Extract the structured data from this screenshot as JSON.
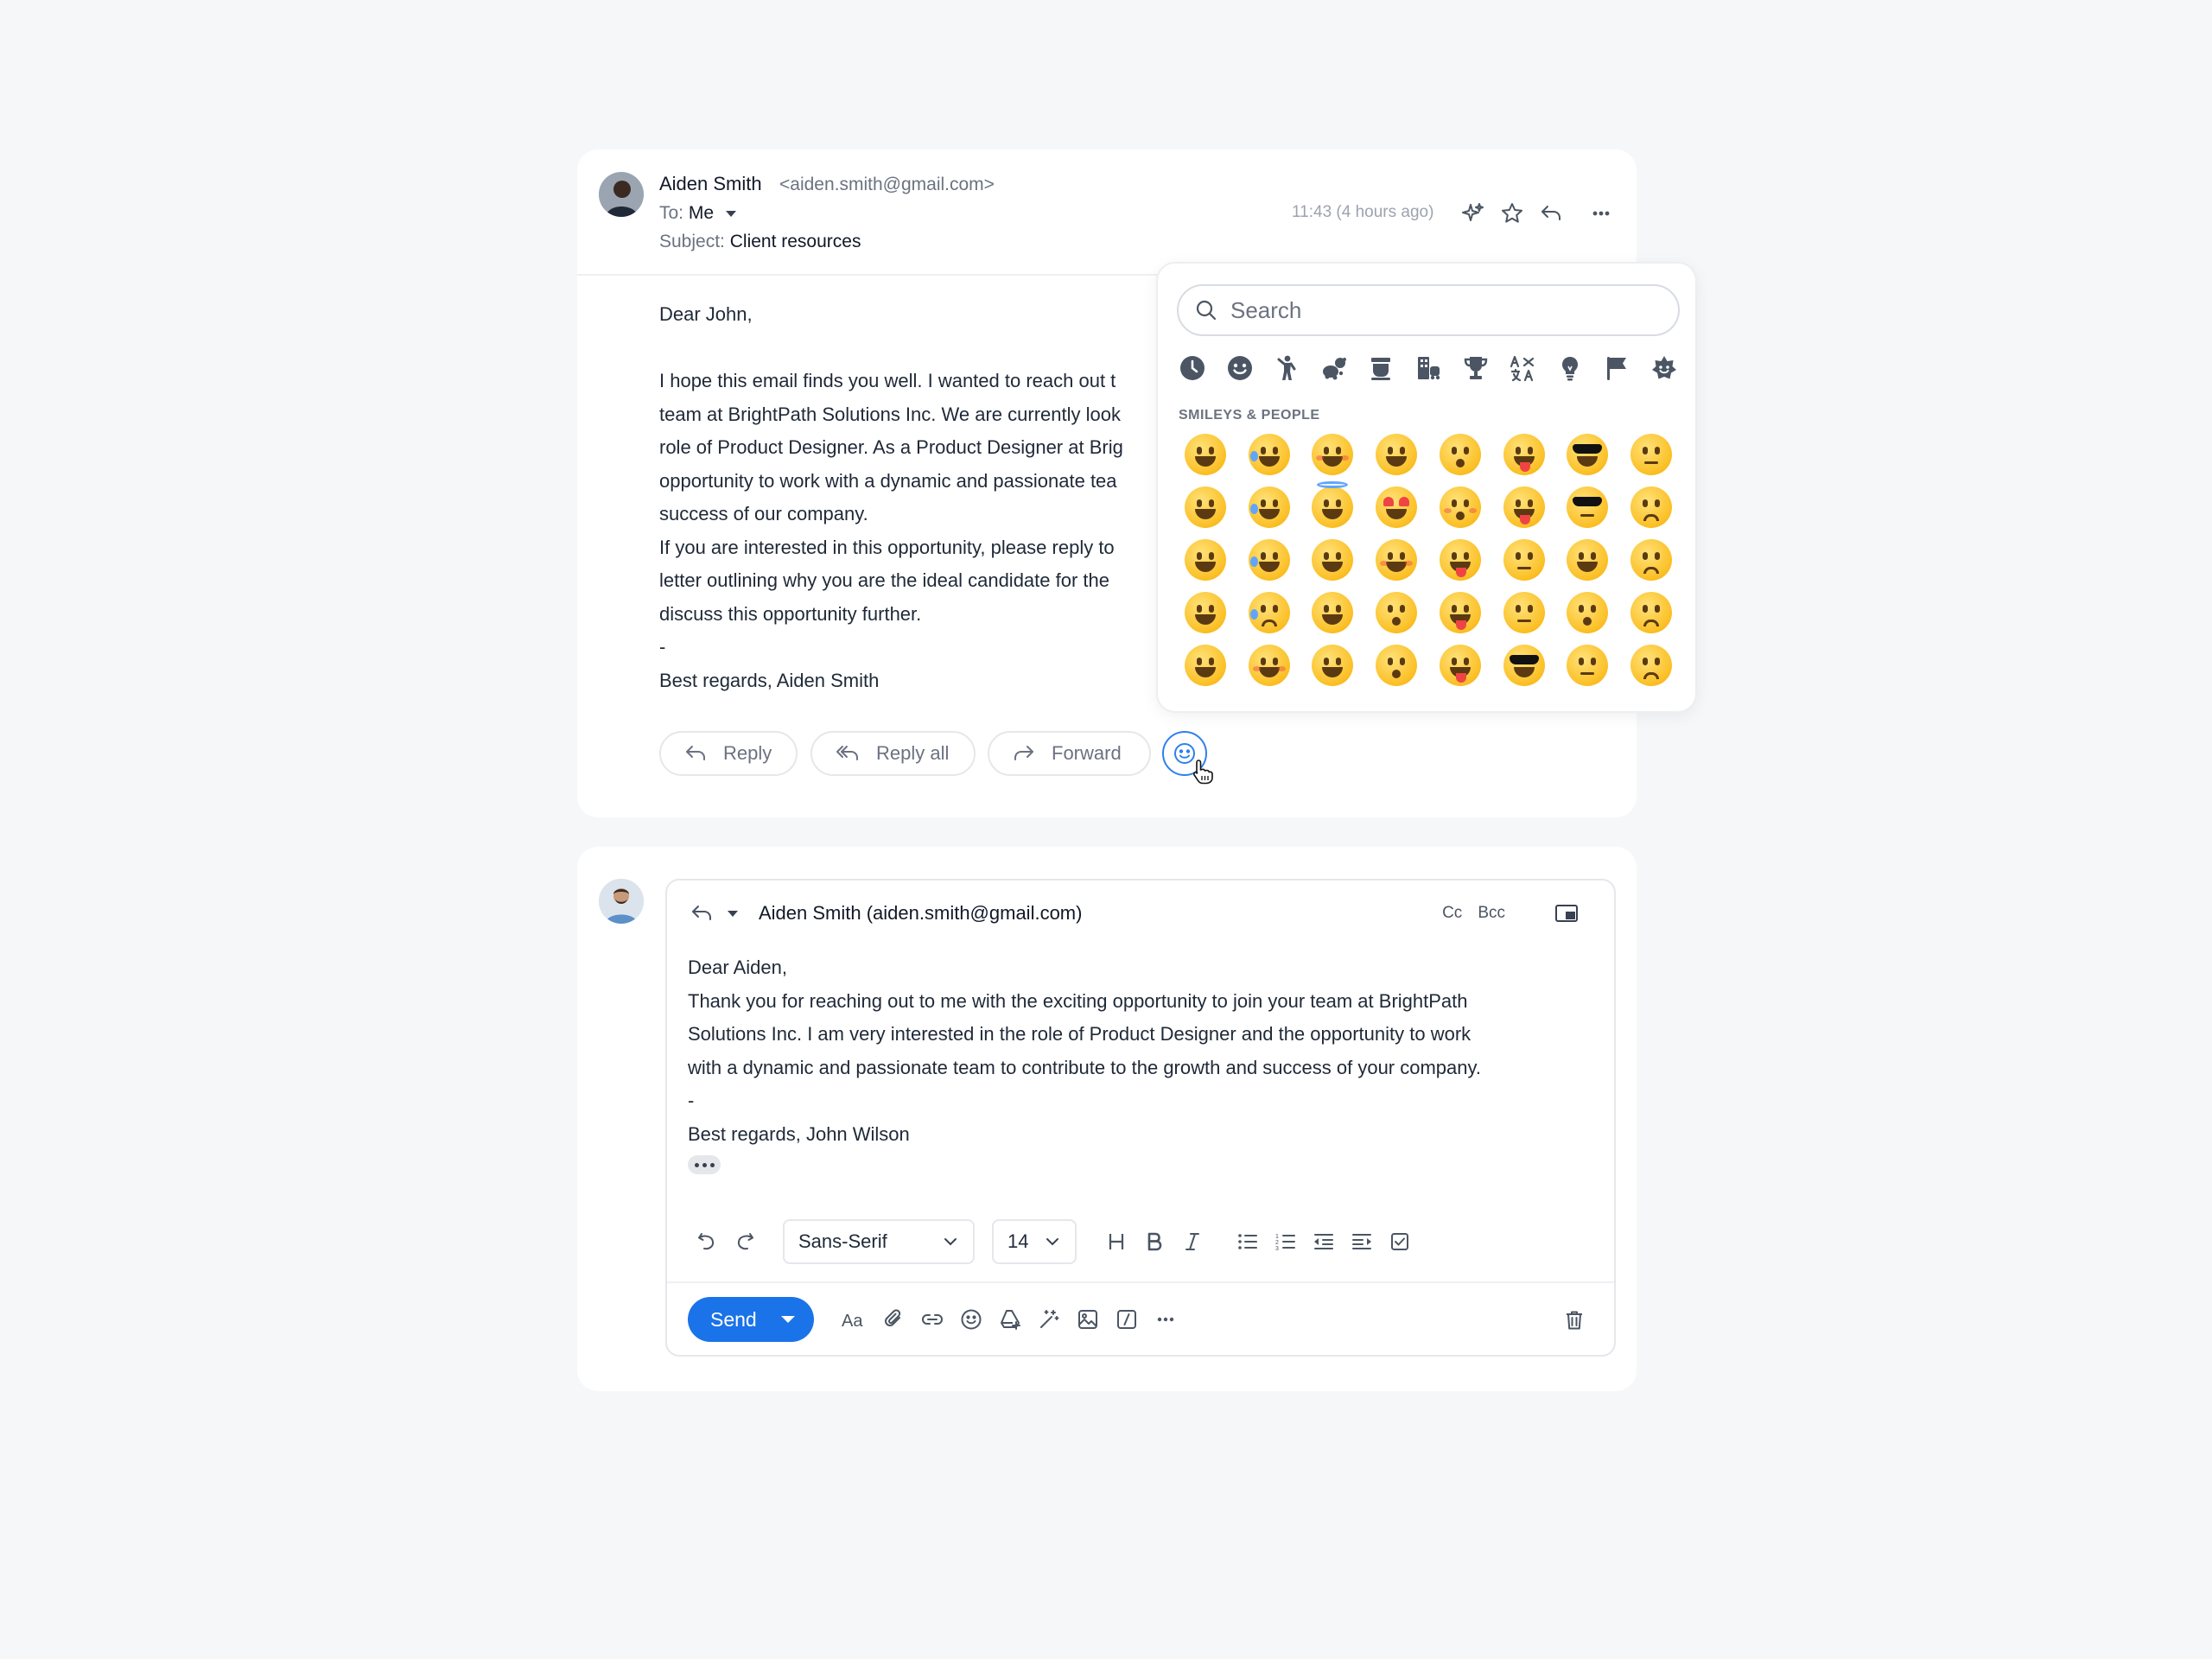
{
  "message": {
    "sender_name": "Aiden Smith",
    "sender_email": "<aiden.smith@gmail.com>",
    "to_label": "To:",
    "to_value": "Me",
    "subject_label": "Subject:",
    "subject_value": "Client resources",
    "time": "11:43 (4 hours ago)",
    "icons": [
      "sparkle-icon",
      "star-icon",
      "reply-icon",
      "more-icon"
    ],
    "body_lines": [
      "Dear John,",
      "",
      "I hope this email finds you well. I wanted to reach out t",
      "team at BrightPath Solutions Inc. We are currently look",
      "role of Product Designer. As a Product Designer at Brig",
      "opportunity to work with a dynamic and passionate tea",
      "success of our company.",
      "If you are interested in this opportunity, please reply to",
      "letter outlining why you are the ideal candidate for the",
      "discuss this opportunity further.",
      "-",
      "Best regards, Aiden Smith"
    ],
    "actions": {
      "reply": "Reply",
      "reply_all": "Reply all",
      "forward": "Forward"
    }
  },
  "emoji_picker": {
    "search_placeholder": "Search",
    "categories": [
      "recent-icon",
      "smiley-icon",
      "person-icon",
      "animals-icon",
      "food-icon",
      "travel-icon",
      "trophy-icon",
      "symbols-icon",
      "lightbulb-icon",
      "flag-icon",
      "custom-icon"
    ],
    "section_title": "SMILEYS & PEOPLE",
    "emojis": [
      "grinning",
      "sweat-smile",
      "smile",
      "relieved",
      "kissing-smiling",
      "winking-tongue",
      "sunglasses",
      "unamused",
      "smiley",
      "joy",
      "halo",
      "heart-eyes",
      "kissing-closed",
      "zany",
      "disguised",
      "disappointed",
      "grin",
      "rofl",
      "slight-smile",
      "hearts",
      "yum",
      "raised-eyebrow",
      "star-struck",
      "pensive",
      "beaming",
      "holding-tears",
      "upside-down",
      "kissing-heart",
      "tongue",
      "monocle",
      "partying",
      "worried",
      "laughing",
      "blush",
      "wink",
      "hushed",
      "squint-tongue",
      "nerd",
      "smirk",
      "confused"
    ]
  },
  "reply": {
    "to": "Aiden Smith (aiden.smith@gmail.com)",
    "cc": "Cc",
    "bcc": "Bcc",
    "body_lines": [
      "Dear Aiden,",
      "Thank you for reaching out to me with the exciting opportunity to join your team at BrightPath",
      "Solutions Inc. I am very interested in the role of Product Designer and the opportunity to work",
      "with a dynamic and passionate team to contribute to the growth and success of your company.",
      "-",
      "Best regards, John Wilson"
    ],
    "font_family": "Sans-Serif",
    "font_size": "14",
    "send": "Send"
  },
  "colors": {
    "accent": "#1a73e8",
    "background": "#f6f7f9",
    "icon": "#4b5563"
  }
}
